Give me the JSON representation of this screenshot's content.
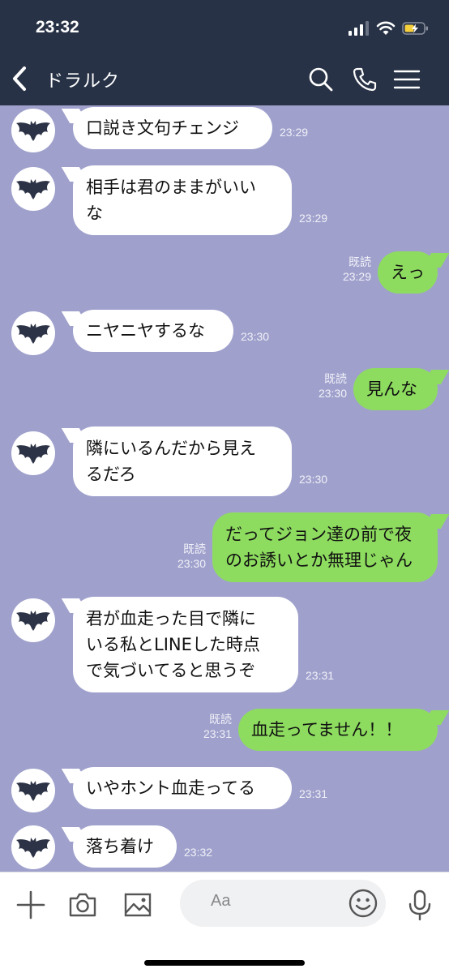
{
  "status_bar": {
    "time": "23:32"
  },
  "header": {
    "back_icon": "chevron-left-icon",
    "title": "ドラルク",
    "icons": [
      "search-icon",
      "phone-icon",
      "menu-icon"
    ]
  },
  "colors": {
    "header_bg": "#273246",
    "chat_bg": "#9fa1cc",
    "bubble_in": "#ffffff",
    "bubble_out": "#8ddc5f"
  },
  "messages": [
    {
      "dir": "in",
      "lines": [
        "口説き文句チェンジ"
      ],
      "time": "23:29"
    },
    {
      "dir": "in",
      "lines": [
        "相手は君のままがいい",
        "な"
      ],
      "time": "23:29"
    },
    {
      "dir": "out",
      "lines": [
        "えっ"
      ],
      "read": "既読",
      "time": "23:29"
    },
    {
      "dir": "in",
      "lines": [
        "ニヤニヤするな"
      ],
      "time": "23:30"
    },
    {
      "dir": "out",
      "lines": [
        "見んな"
      ],
      "read": "既読",
      "time": "23:30"
    },
    {
      "dir": "in",
      "lines": [
        "隣にいるんだから見え",
        "るだろ"
      ],
      "time": "23:30"
    },
    {
      "dir": "out",
      "lines": [
        "だってジョン達の前で夜",
        "のお誘いとか無理じゃん"
      ],
      "read": "既読",
      "time": "23:30"
    },
    {
      "dir": "in",
      "lines": [
        "君が血走った目で隣に",
        "いる私とLINEした時点",
        "で気づいてると思うぞ"
      ],
      "time": "23:31"
    },
    {
      "dir": "out",
      "lines": [
        "血走ってません！！"
      ],
      "read": "既読",
      "time": "23:31"
    },
    {
      "dir": "in",
      "lines": [
        "いやホント血走ってる"
      ],
      "time": "23:31"
    },
    {
      "dir": "in",
      "lines": [
        "落ち着け"
      ],
      "time": "23:32"
    }
  ],
  "input": {
    "placeholder": "Aa",
    "icons": [
      "plus-icon",
      "camera-icon",
      "image-icon",
      "emoji-icon",
      "microphone-icon"
    ]
  }
}
